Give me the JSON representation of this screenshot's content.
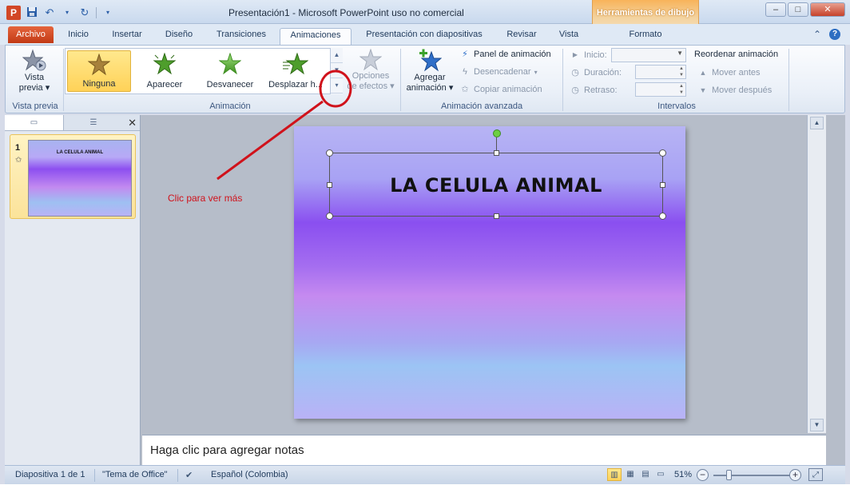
{
  "window": {
    "title": "Presentación1 - Microsoft PowerPoint uso no comercial",
    "contextual_tab_group": "Herramientas de dibujo",
    "app_letter": "P",
    "controls": {
      "minimize": "–",
      "maximize": "□",
      "close": "✕"
    }
  },
  "tabs": [
    {
      "label": "Archivo"
    },
    {
      "label": "Inicio"
    },
    {
      "label": "Insertar"
    },
    {
      "label": "Diseño"
    },
    {
      "label": "Transiciones"
    },
    {
      "label": "Animaciones"
    },
    {
      "label": "Presentación con diapositivas"
    },
    {
      "label": "Revisar"
    },
    {
      "label": "Vista"
    },
    {
      "label": "Formato"
    }
  ],
  "active_tab": "Animaciones",
  "ribbon": {
    "preview": {
      "label1": "Vista",
      "label2": "previa",
      "group": "Vista previa"
    },
    "animation_group": {
      "label": "Animación",
      "items": [
        {
          "label": "Ninguna",
          "selected": true
        },
        {
          "label": "Aparecer",
          "selected": false
        },
        {
          "label": "Desvanecer",
          "selected": false
        },
        {
          "label": "Desplazar h...",
          "selected": false
        }
      ],
      "effect_options1": "Opciones",
      "effect_options2": "de efectos"
    },
    "advanced_group": {
      "label": "Animación avanzada",
      "add1": "Agregar",
      "add2": "animación",
      "panel": "Panel de animación",
      "trigger": "Desencadenar",
      "copy": "Copiar animación"
    },
    "timing_group": {
      "label": "Intervalos",
      "start": "Inicio:",
      "duration": "Duración:",
      "delay": "Retraso:",
      "reorder": "Reordenar animación",
      "move_earlier": "Mover antes",
      "move_later": "Mover después"
    }
  },
  "slides_pane": {
    "slide_number": "1",
    "thumb_title": "LA CELULA ANIMAL"
  },
  "slide": {
    "title": "LA CELULA ANIMAL"
  },
  "notes": {
    "placeholder": "Haga clic para agregar notas"
  },
  "annotation": {
    "text": "Clic para ver más",
    "color": "#d0121b"
  },
  "statusbar": {
    "slide_info": "Diapositiva 1 de 1",
    "theme": "\"Tema de Office\"",
    "language": "Español (Colombia)",
    "zoom": "51%",
    "zoom_minus": "−",
    "zoom_plus": "+"
  },
  "colors": {
    "file_tab": "#c23a15",
    "selected_item": "#ffd258",
    "contextual_header": "#f8b35a"
  }
}
